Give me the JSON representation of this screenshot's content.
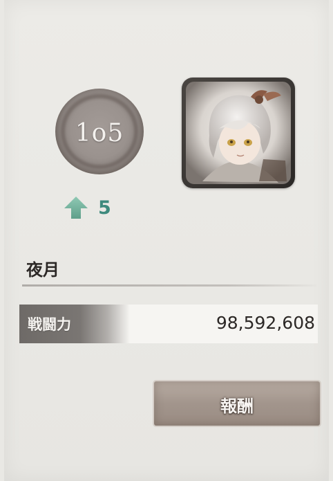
{
  "rank": {
    "level": "1o5",
    "change_icon": "up-arrow-icon",
    "change_value": "5",
    "change_color": "#3e8a7d"
  },
  "player": {
    "portrait": "character-portrait",
    "name": "夜月"
  },
  "power": {
    "label": "戦闘力",
    "value": "98,592,608"
  },
  "reward_button": {
    "label": "報酬"
  }
}
